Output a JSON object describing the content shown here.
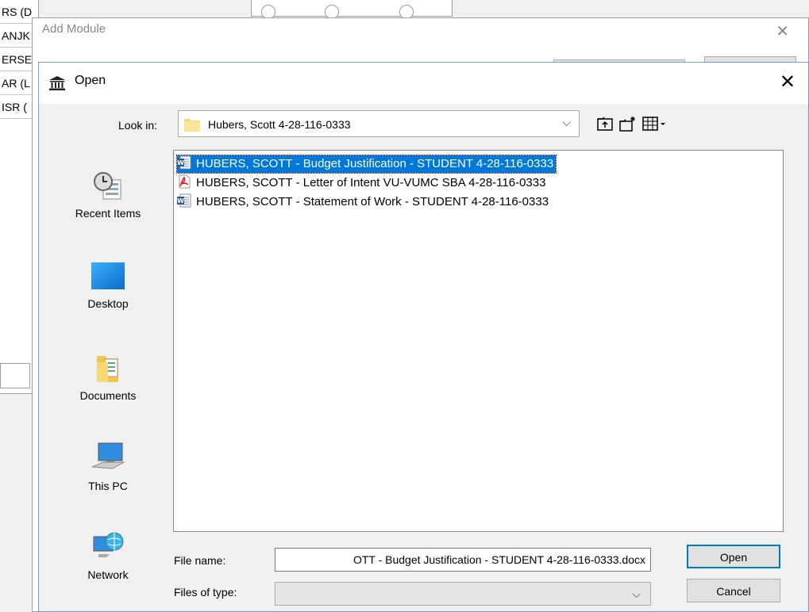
{
  "background": {
    "rows": [
      "RS (D",
      "ANJK",
      "ERSE",
      "AR (L",
      "ISR ("
    ]
  },
  "add_module": {
    "title": "Add Module",
    "close_glyph": "✕"
  },
  "dialog": {
    "title": "Open",
    "close_glyph": "✕",
    "look_in_label": "Look in:",
    "look_in_value": "Hubers, Scott 4-28-116-0333",
    "dropdown_glyph": "⌵",
    "places": [
      {
        "label": "Recent Items",
        "icon": "recent-items-icon"
      },
      {
        "label": "Desktop",
        "icon": "desktop-icon"
      },
      {
        "label": "Documents",
        "icon": "documents-icon"
      },
      {
        "label": "This PC",
        "icon": "this-pc-icon"
      },
      {
        "label": "Network",
        "icon": "network-icon"
      }
    ],
    "files": [
      {
        "name": "HUBERS, SCOTT - Budget Justification - STUDENT 4-28-116-0333",
        "type": "word-doc-icon",
        "selected": true
      },
      {
        "name": "HUBERS, SCOTT - Letter of Intent VU-VUMC SBA 4-28-116-0333",
        "type": "pdf-icon",
        "selected": false
      },
      {
        "name": "HUBERS, SCOTT - Statement of Work - STUDENT 4-28-116-0333",
        "type": "word-doc-icon",
        "selected": false
      }
    ],
    "file_name_label": "File name:",
    "file_name_value": "OTT - Budget Justification - STUDENT 4-28-116-0333.docx",
    "files_of_type_label": "Files of type:",
    "files_of_type_value": "",
    "open_label": "Open",
    "cancel_label": "Cancel",
    "colors": {
      "selection": "#0078d7",
      "accent_border": "#0078d7"
    }
  }
}
